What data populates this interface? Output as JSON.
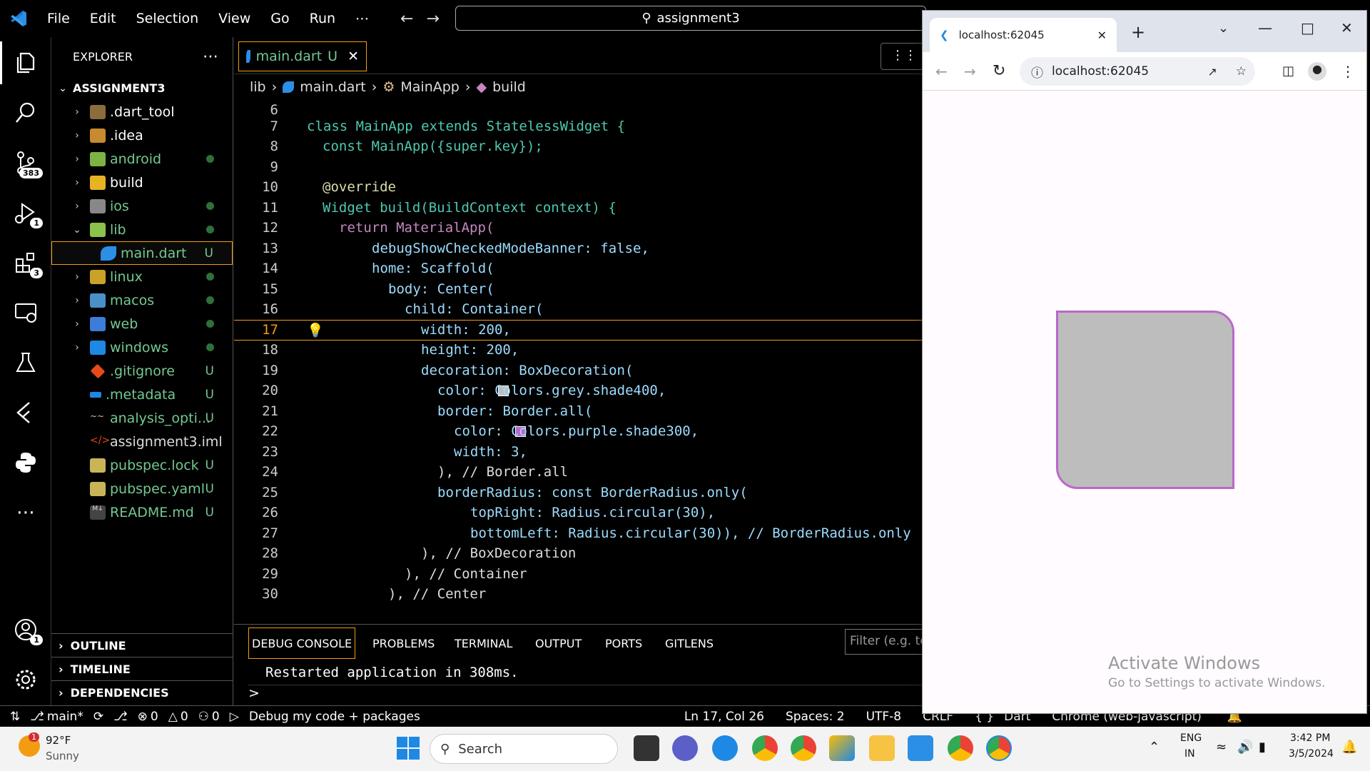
{
  "titlebar": {
    "menus": [
      "File",
      "Edit",
      "Selection",
      "View",
      "Go",
      "Run",
      "⋯"
    ],
    "search": "assignment3"
  },
  "activity": {
    "source_control_badge": "383",
    "run_badge": "1",
    "extensions_badge": "3",
    "accounts_badge": "1"
  },
  "explorer": {
    "title": "EXPLORER",
    "more": "⋯",
    "root": "ASSIGNMENT3",
    "items": [
      {
        "label": ".dart_tool",
        "status": ""
      },
      {
        "label": ".idea",
        "status": ""
      },
      {
        "label": "android",
        "status": "dot"
      },
      {
        "label": "build",
        "status": ""
      },
      {
        "label": "ios",
        "status": "dot"
      },
      {
        "label": "lib",
        "status": "dot"
      },
      {
        "label": "main.dart",
        "status": "U"
      },
      {
        "label": "linux",
        "status": "dot"
      },
      {
        "label": "macos",
        "status": "dot"
      },
      {
        "label": "web",
        "status": "dot"
      },
      {
        "label": "windows",
        "status": "dot"
      },
      {
        "label": ".gitignore",
        "status": "U"
      },
      {
        "label": ".metadata",
        "status": "U"
      },
      {
        "label": "analysis_opti...",
        "status": "U"
      },
      {
        "label": "assignment3.iml",
        "status": ""
      },
      {
        "label": "pubspec.lock",
        "status": "U"
      },
      {
        "label": "pubspec.yaml",
        "status": "U"
      },
      {
        "label": "README.md",
        "status": "U"
      }
    ],
    "sections": [
      "OUTLINE",
      "TIMELINE",
      "DEPENDENCIES"
    ]
  },
  "editor": {
    "tab_label": "main.dart",
    "tab_status": "U",
    "breadcrumb": [
      "lib",
      "main.dart",
      "MainApp",
      "build"
    ],
    "line_numbers": [
      "6",
      "7",
      "8",
      "9",
      "10",
      "11",
      "12",
      "13",
      "14",
      "15",
      "16",
      "17",
      "18",
      "19",
      "20",
      "21",
      "22",
      "23",
      "24",
      "25",
      "26",
      "27",
      "28",
      "29",
      "30"
    ],
    "code": {
      "l7": "class MainApp extends StatelessWidget {",
      "l8": "const MainApp({super.key});",
      "l10": "@override",
      "l11": "Widget build(BuildContext context) {",
      "l12": "return MaterialApp(",
      "l13": "debugShowCheckedModeBanner: false,",
      "l14": "home: Scaffold(",
      "l15": "body: Center(",
      "l16": "child: Container(",
      "l17": "width: 200,",
      "l18": "height: 200,",
      "l19": "decoration: BoxDecoration(",
      "l20": "color: Colors.grey.shade400,",
      "l21": "border: Border.all(",
      "l22": "color: Colors.purple.shade300,",
      "l23": "width: 3,",
      "l24": "), // Border.all",
      "l25": "borderRadius: const BorderRadius.only(",
      "l26": "topRight: Radius.circular(30),",
      "l27": "bottomLeft: Radius.circular(30)), // BorderRadius.only",
      "l28": "), // BoxDecoration",
      "l29": "), // Container",
      "l30": "), // Center"
    }
  },
  "panel": {
    "tabs": [
      "DEBUG CONSOLE",
      "PROBLEMS",
      "TERMINAL",
      "OUTPUT",
      "PORTS",
      "GITLENS"
    ],
    "filter_placeholder": "Filter (e.g. te",
    "output": "Restarted application in 308ms.",
    "prompt": ">"
  },
  "statusbar": {
    "branch": "main*",
    "errors": "0",
    "warnings": "0",
    "ports": "0",
    "debug": "Debug my code + packages",
    "position": "Ln 17, Col 26",
    "spaces": "Spaces: 2",
    "encoding": "UTF-8",
    "eol": "CRLF",
    "language": "Dart",
    "device": "Chrome (web-javascript)"
  },
  "browser": {
    "tab_title": "localhost:62045",
    "url": "localhost:62045",
    "watermark_title": "Activate Windows",
    "watermark_sub": "Go to Settings to activate Windows.",
    "box_color": "#bdbdbd",
    "border_color": "#ba68c8"
  },
  "taskbar": {
    "weather_temp": "92°F",
    "weather_desc": "Sunny",
    "weather_badge": "1",
    "search": "Search",
    "lang1": "ENG",
    "lang2": "IN",
    "time": "3:42 PM",
    "date": "3/5/2024"
  }
}
